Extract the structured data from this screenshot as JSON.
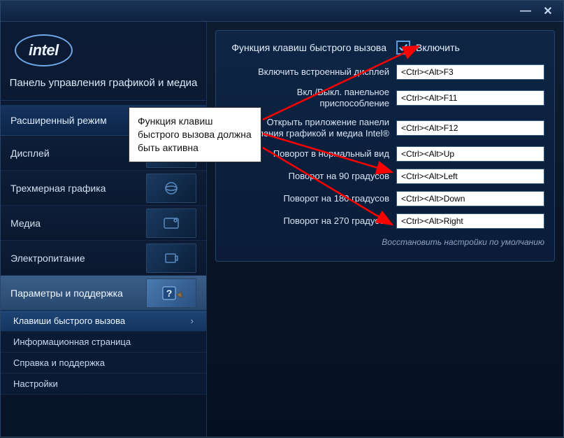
{
  "window": {
    "min": "—",
    "close": "✕"
  },
  "logo": "intel",
  "panel_title": "Панель управления графикой и медиа",
  "sidebar": {
    "advanced": "Расширенный режим",
    "items": [
      {
        "label": "Дисплей"
      },
      {
        "label": "Трехмерная графика"
      },
      {
        "label": "Медиа"
      },
      {
        "label": "Электропитание"
      },
      {
        "label": "Параметры и поддержка"
      }
    ],
    "sub": [
      {
        "label": "Клавиши быстрого вызова"
      },
      {
        "label": "Информационная страница"
      },
      {
        "label": "Справка и поддержка"
      },
      {
        "label": "Настройки"
      }
    ]
  },
  "content": {
    "hotkey_function": "Функция клавиш быстрого вызова",
    "enable": "Включить",
    "checked": true,
    "rows": [
      {
        "label": "Включить встроенный дисплей",
        "value": "<Ctrl><Alt>F3"
      },
      {
        "label": "Вкл./Выкл. панельное приспособление",
        "value": "<Ctrl><Alt>F11"
      },
      {
        "label": "Открыть приложение панели управления графикой и медиа Intel®",
        "value": "<Ctrl><Alt>F12"
      },
      {
        "label": "Поворот в нормальный вид",
        "value": "<Ctrl><Alt>Up"
      },
      {
        "label": "Поворот на 90 градусов",
        "value": "<Ctrl><Alt>Left"
      },
      {
        "label": "Поворот на 180 градусов",
        "value": "<Ctrl><Alt>Down"
      },
      {
        "label": "Поворот на 270 градусов",
        "value": "<Ctrl><Alt>Right"
      }
    ],
    "reset": "Восстановить настройки по умолчанию"
  },
  "callout": "Функция клавиш быстрого вызова должна быть активна"
}
